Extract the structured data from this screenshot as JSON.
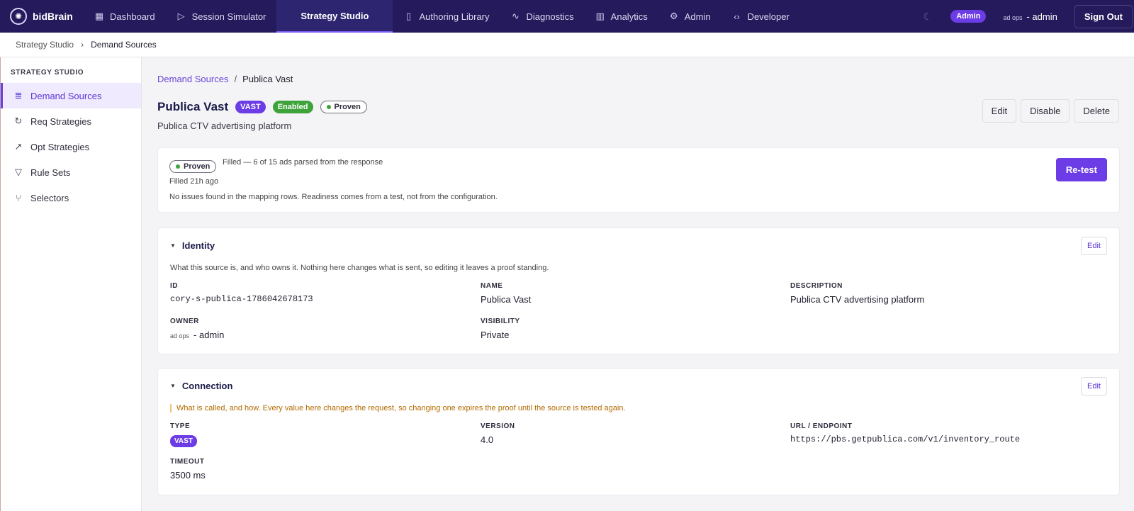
{
  "app": {
    "name": "bidBrain"
  },
  "topnav": {
    "items": [
      {
        "label": "Dashboard",
        "icon": "dashboard-icon"
      },
      {
        "label": "Session Simulator",
        "icon": "play-icon"
      },
      {
        "label": "Strategy Studio",
        "icon": "",
        "active": true
      },
      {
        "label": "Authoring Library",
        "icon": "book-icon"
      },
      {
        "label": "Diagnostics",
        "icon": "activity-icon"
      },
      {
        "label": "Analytics",
        "icon": "bar-chart-icon"
      },
      {
        "label": "Admin",
        "icon": "gear-icon"
      },
      {
        "label": "Developer",
        "icon": "code-icon"
      }
    ],
    "role_badge": "Admin",
    "user_prefix": "ad ops",
    "user_name": "- admin",
    "signout_label": "Sign Out"
  },
  "subbar": {
    "parent": "Strategy Studio",
    "current": "Demand Sources"
  },
  "sidebar": {
    "section_label": "STRATEGY STUDIO",
    "items": [
      {
        "label": "Demand Sources",
        "icon": "database-icon",
        "active": true
      },
      {
        "label": "Req Strategies",
        "icon": "refresh-icon"
      },
      {
        "label": "Opt Strategies",
        "icon": "trending-up-icon"
      },
      {
        "label": "Rule Sets",
        "icon": "filter-icon"
      },
      {
        "label": "Selectors",
        "icon": "branch-icon"
      }
    ]
  },
  "page": {
    "breadcrumb_parent": "Demand Sources",
    "breadcrumb_sep": "/",
    "breadcrumb_current": "Publica Vast",
    "title": "Publica Vast",
    "badge_type": "VAST",
    "badge_status": "Enabled",
    "badge_proof": "Proven",
    "subtitle": "Publica CTV advertising platform",
    "actions": {
      "edit": "Edit",
      "disable": "Disable",
      "delete": "Delete"
    }
  },
  "status": {
    "badge": "Proven",
    "filled_text": "Filled — 6 of 15 ads parsed from the response",
    "ago": "Filled 21h ago",
    "note": "No issues found in the mapping rows. Readiness comes from a test, not from the configuration.",
    "retest_label": "Re-test"
  },
  "identity": {
    "title": "Identity",
    "edit_label": "Edit",
    "description": "What this source is, and who owns it. Nothing here changes what is sent, so editing it leaves a proof standing.",
    "id_label": "ID",
    "id_value": "cory-s-publica-1786042678173",
    "name_label": "NAME",
    "name_value": "Publica Vast",
    "desc_label": "DESCRIPTION",
    "desc_value": "Publica CTV advertising platform",
    "owner_label": "OWNER",
    "owner_prefix": "ad ops",
    "owner_value": "- admin",
    "visibility_label": "VISIBILITY",
    "visibility_value": "Private"
  },
  "connection": {
    "title": "Connection",
    "edit_label": "Edit",
    "description": "What is called, and how. Every value here changes the request, so changing one expires the proof until the source is tested again.",
    "type_label": "TYPE",
    "type_value": "VAST",
    "version_label": "VERSION",
    "version_value": "4.0",
    "url_label": "URL / ENDPOINT",
    "url_value": "https://pbs.getpublica.com/v1/inventory_route",
    "timeout_label": "TIMEOUT",
    "timeout_value": "3500 ms"
  }
}
